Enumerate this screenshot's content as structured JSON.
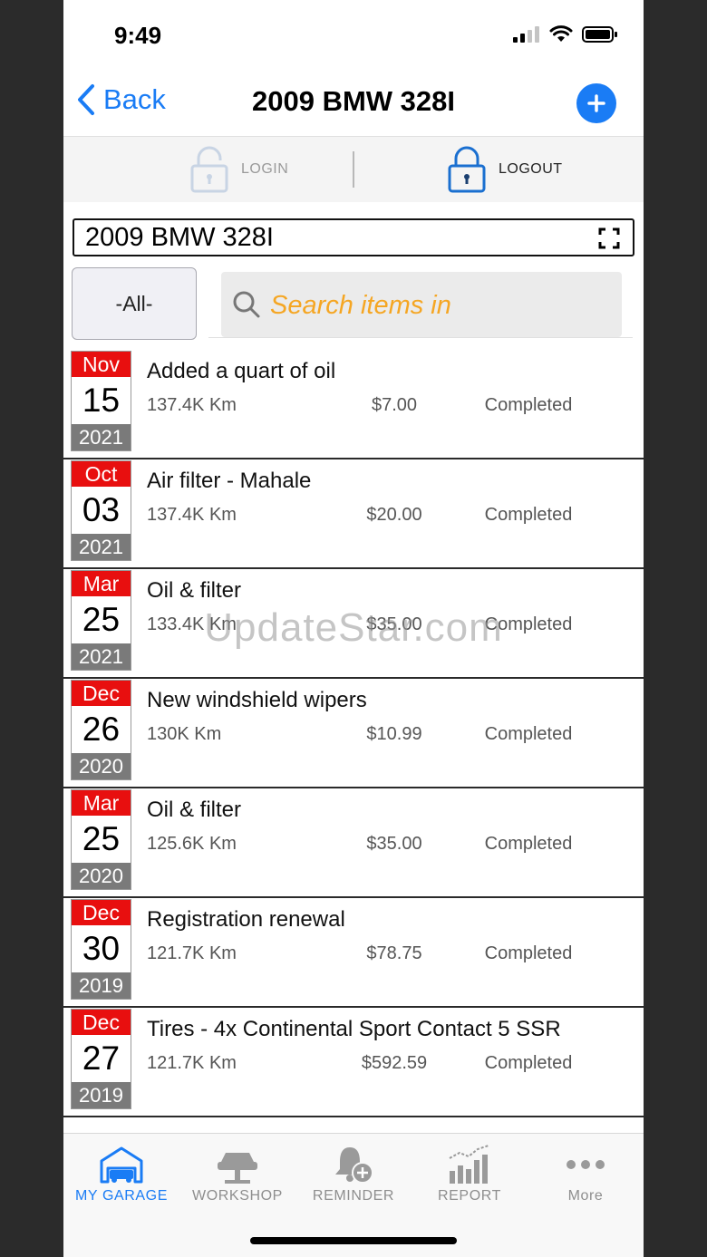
{
  "status_bar": {
    "time": "9:49"
  },
  "nav": {
    "back_label": "Back",
    "title": "2009 BMW 328I"
  },
  "login_bar": {
    "login_label": "LOGIN",
    "logout_label": "LOGOUT"
  },
  "vehicle_selector": {
    "value": "2009 BMW 328I"
  },
  "filter": {
    "selected": "-All-"
  },
  "search": {
    "placeholder": "Search items in"
  },
  "entries": [
    {
      "month": "Nov",
      "day": "15",
      "year": "2021",
      "title": "Added a quart of oil",
      "mileage": "137.4K Km",
      "cost": "$7.00",
      "status": "Completed"
    },
    {
      "month": "Oct",
      "day": "03",
      "year": "2021",
      "title": "Air filter - Mahale",
      "mileage": "137.4K Km",
      "cost": "$20.00",
      "status": "Completed"
    },
    {
      "month": "Mar",
      "day": "25",
      "year": "2021",
      "title": "Oil & filter",
      "mileage": "133.4K Km",
      "cost": "$35.00",
      "status": "Completed"
    },
    {
      "month": "Dec",
      "day": "26",
      "year": "2020",
      "title": "New windshield wipers",
      "mileage": "130K Km",
      "cost": "$10.99",
      "status": "Completed"
    },
    {
      "month": "Mar",
      "day": "25",
      "year": "2020",
      "title": "Oil & filter",
      "mileage": "125.6K Km",
      "cost": "$35.00",
      "status": "Completed"
    },
    {
      "month": "Dec",
      "day": "30",
      "year": "2019",
      "title": "Registration renewal",
      "mileage": "121.7K Km",
      "cost": "$78.75",
      "status": "Completed"
    },
    {
      "month": "Dec",
      "day": "27",
      "year": "2019",
      "title": "Tires - 4x Continental Sport Contact 5 SSR",
      "mileage": "121.7K Km",
      "cost": "$592.59",
      "status": "Completed"
    }
  ],
  "watermark": "UpdateStar.com",
  "tabs": [
    {
      "label": "MY GARAGE",
      "icon": "car-icon",
      "active": true
    },
    {
      "label": "WORKSHOP",
      "icon": "car-lift-icon",
      "active": false
    },
    {
      "label": "REMINDER",
      "icon": "bell-plus-icon",
      "active": false
    },
    {
      "label": "REPORT",
      "icon": "bar-chart-icon",
      "active": false
    },
    {
      "label": "More",
      "icon": "more-dots-icon",
      "active": false
    }
  ],
  "colors": {
    "accent": "#1a7cf5",
    "date_red": "#e80f0f",
    "year_gray": "#7a7a7a",
    "search_text": "#f5a623"
  }
}
